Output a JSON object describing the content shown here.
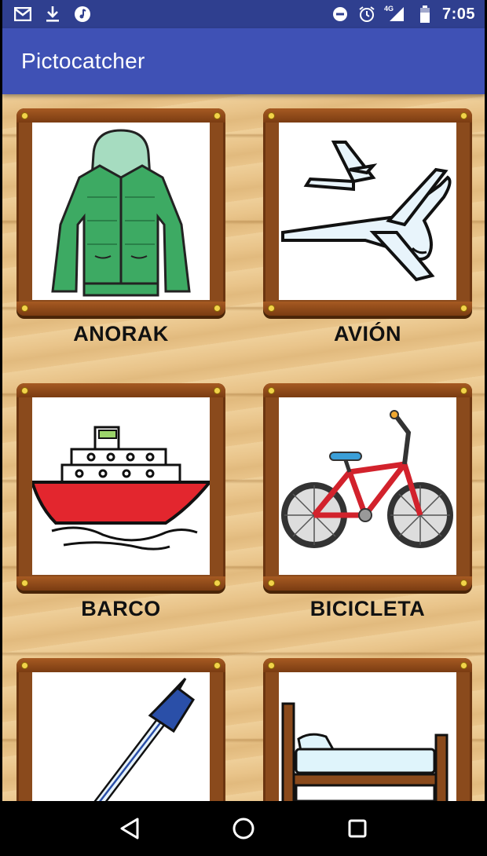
{
  "status_bar": {
    "time": "7:05",
    "network": "4G",
    "left_icons": [
      "gmail-icon",
      "download-icon",
      "music-icon"
    ],
    "right_icons": [
      "do-not-disturb-icon",
      "alarm-icon",
      "signal-icon",
      "battery-icon"
    ]
  },
  "app_bar": {
    "title": "Pictocatcher"
  },
  "grid": {
    "items": [
      {
        "label": "ANORAK",
        "icon": "anorak-picture"
      },
      {
        "label": "AVIÓN",
        "icon": "airplane-picture"
      },
      {
        "label": "BARCO",
        "icon": "ship-picture"
      },
      {
        "label": "BICICLETA",
        "icon": "bicycle-picture"
      },
      {
        "label": "",
        "icon": "pen-picture"
      },
      {
        "label": "",
        "icon": "bed-picture"
      }
    ]
  },
  "nav_bar": {
    "buttons": [
      "back-icon",
      "home-icon",
      "recents-icon"
    ]
  },
  "colors": {
    "status_bar": "#2f3f8f",
    "app_bar": "#3f51b5",
    "wood_background": "#e9c48a",
    "frame": "#8a4a1c"
  }
}
